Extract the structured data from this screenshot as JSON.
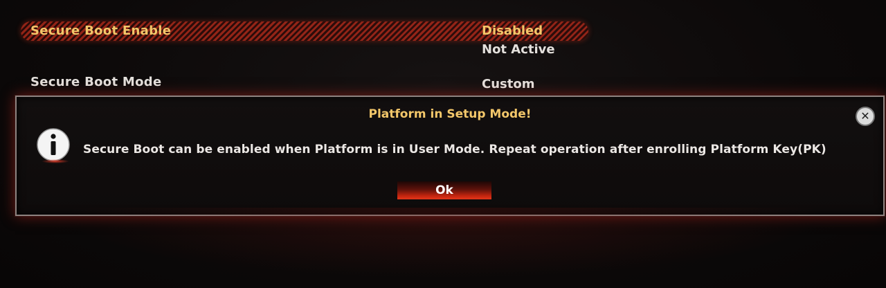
{
  "settings": {
    "secure_boot_enable": {
      "label": "Secure Boot Enable",
      "value": "Disabled",
      "status": "Not Active"
    },
    "secure_boot_mode": {
      "label": "Secure Boot Mode",
      "value": "Custom"
    }
  },
  "dialog": {
    "title": "Platform in Setup Mode!",
    "message": "Secure Boot can be enabled when Platform is in User Mode. Repeat operation after enrolling Platform Key(PK)",
    "ok_label": "Ok",
    "close_icon": "close-icon",
    "info_icon": "info-icon"
  },
  "colors": {
    "highlight_text": "#f3c76a",
    "highlight_bar": "#aa2819",
    "ok_button": "#c3250f",
    "background": "#0b0909"
  }
}
